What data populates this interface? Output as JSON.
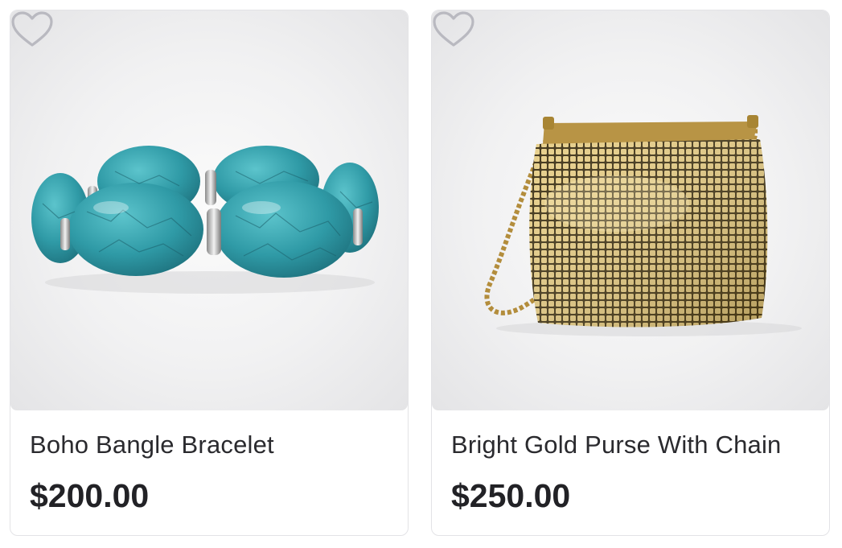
{
  "products": [
    {
      "name": "Boho Bangle Bracelet",
      "price": "$200.00",
      "image": "turquoise-bracelet",
      "favorite_icon": "heart-outline-icon"
    },
    {
      "name": "Bright Gold Purse With Chain",
      "price": "$250.00",
      "image": "gold-mesh-purse",
      "favorite_icon": "heart-outline-icon"
    }
  ],
  "colors": {
    "heart_stroke": "#b9b9c0",
    "turquoise": "#3aa3ad",
    "gold": "#c9a64a"
  }
}
